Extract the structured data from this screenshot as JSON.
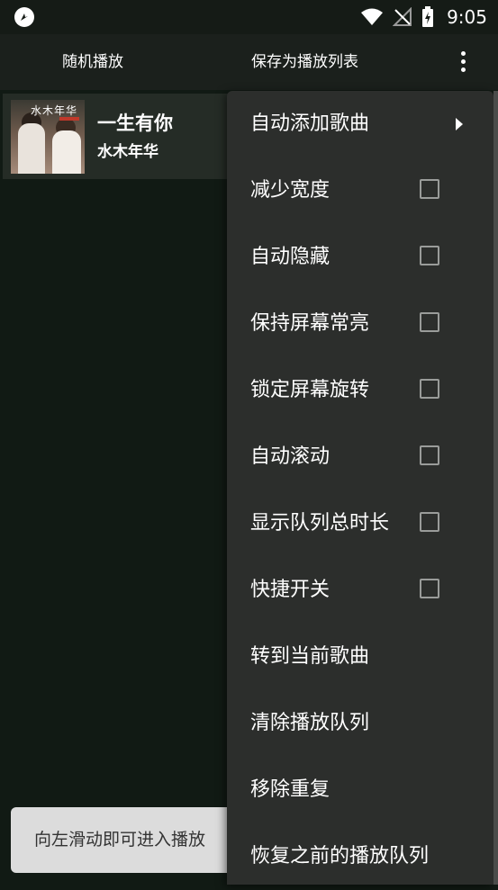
{
  "status_bar": {
    "time": "9:05",
    "icons": [
      "app-notification-icon",
      "wifi-icon",
      "no-signal-icon",
      "battery-charging-icon"
    ]
  },
  "toolbar": {
    "shuffle_label": "随机播放",
    "save_playlist_label": "保存为播放列表",
    "more_icon": "more-vert-icon"
  },
  "queue": {
    "items": [
      {
        "title": "一生有你",
        "artist": "水木年华",
        "album_art_text": "水木年华"
      }
    ]
  },
  "toast": {
    "text": "向左滑动即可进入播放"
  },
  "menu": {
    "items": [
      {
        "label": "自动添加歌曲",
        "submenu": true
      },
      {
        "label": "减少宽度",
        "checked": false
      },
      {
        "label": "自动隐藏",
        "checked": false
      },
      {
        "label": "保持屏幕常亮",
        "checked": false
      },
      {
        "label": "锁定屏幕旋转",
        "checked": false
      },
      {
        "label": "自动滚动",
        "checked": false
      },
      {
        "label": "显示队列总时长",
        "checked": false
      },
      {
        "label": "快捷开关",
        "checked": false
      },
      {
        "label": "转到当前歌曲"
      },
      {
        "label": "清除播放队列"
      },
      {
        "label": "移除重复"
      },
      {
        "label": "恢复之前的播放队列"
      }
    ]
  },
  "colors": {
    "background": "#111a14",
    "toolbar": "#1b201c",
    "menu": "#2c2e2c",
    "queue_item": "#252c26",
    "toast": "#dcdcdc"
  }
}
